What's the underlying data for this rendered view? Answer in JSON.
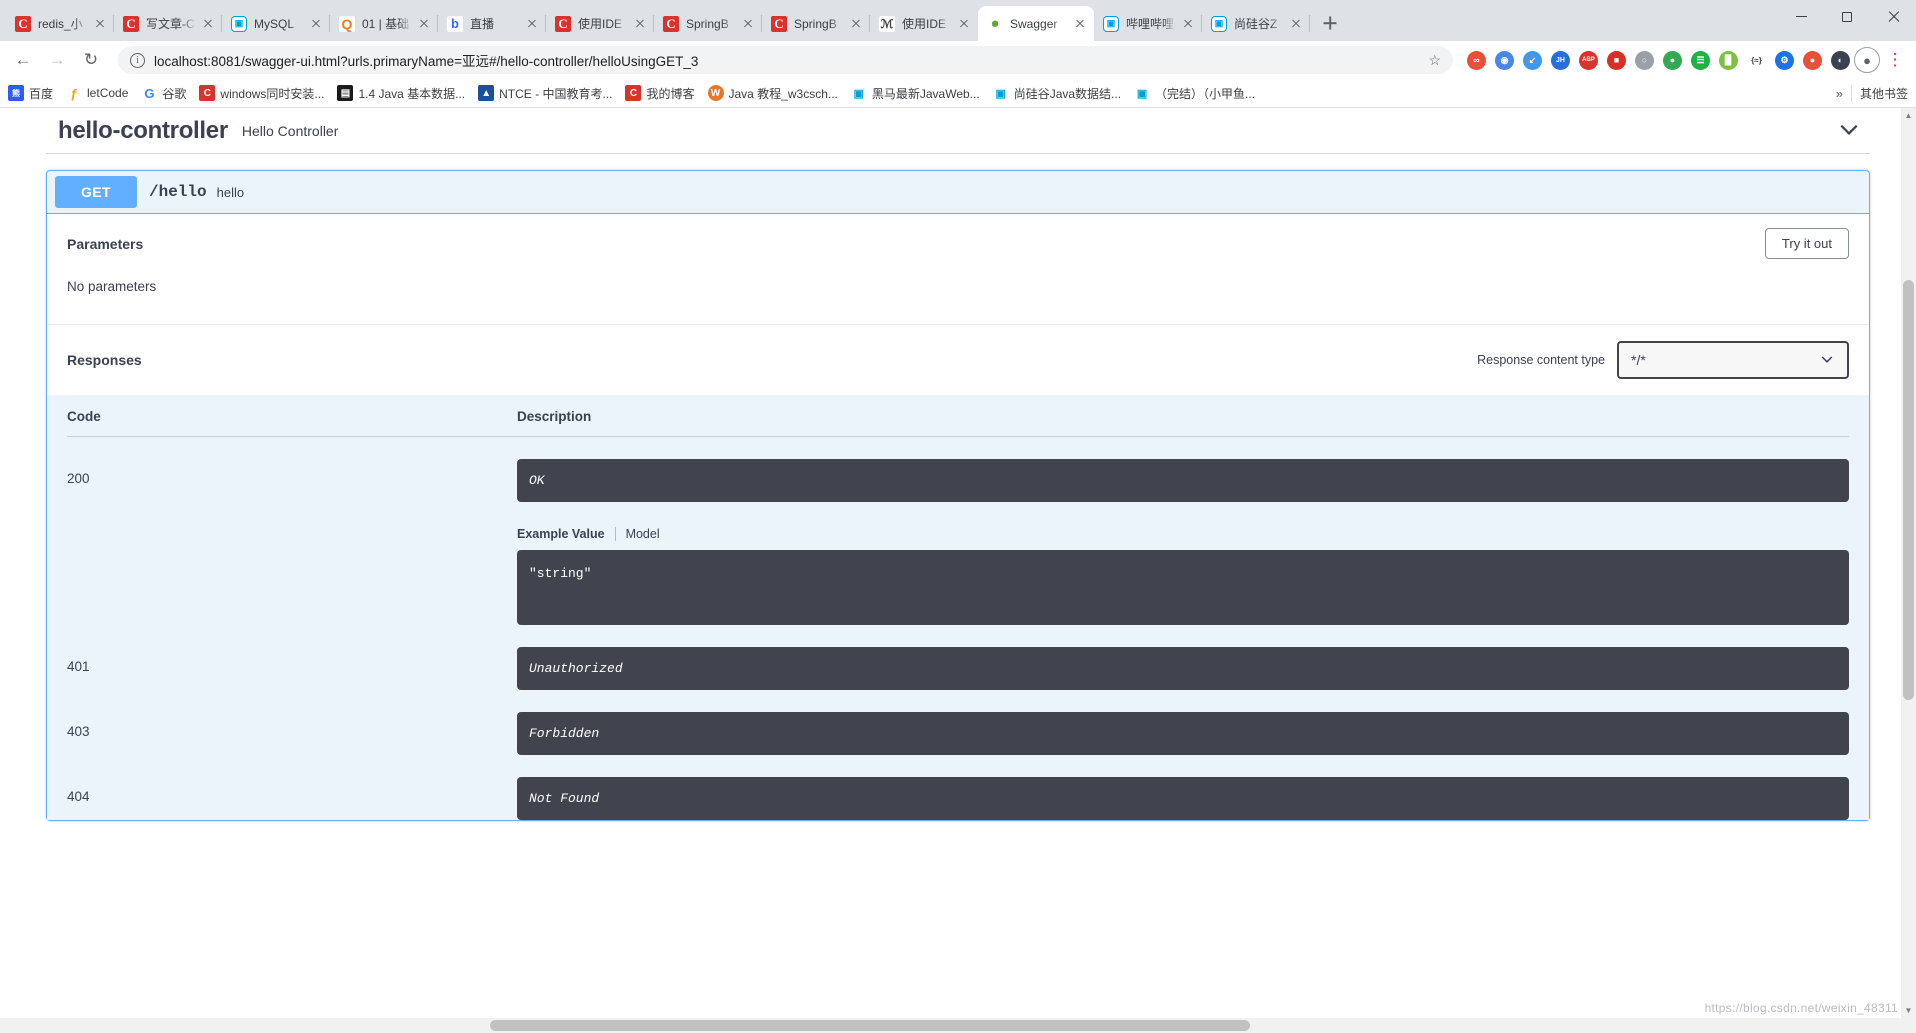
{
  "browser": {
    "tabs": [
      {
        "title": "redis_小",
        "icon": "csdn-icon",
        "icon_class": "fav-csdn",
        "glyph": "C",
        "active": false
      },
      {
        "title": "写文章-C",
        "icon": "csdn-icon",
        "icon_class": "fav-csdn",
        "glyph": "C",
        "active": false
      },
      {
        "title": "MySQL ",
        "icon": "bilibili-icon",
        "icon_class": "fav-bili",
        "glyph": "■■",
        "active": false
      },
      {
        "title": "01 | 基础",
        "icon": "qcon-icon",
        "icon_class": "fav-q",
        "glyph": "Q",
        "active": false
      },
      {
        "title": "直播",
        "icon": "zhibo-icon",
        "icon_class": "fav-zhibo",
        "glyph": "b",
        "active": false
      },
      {
        "title": "使用IDE",
        "icon": "csdn-icon",
        "icon_class": "fav-csdn",
        "glyph": "C",
        "active": false
      },
      {
        "title": "SpringB",
        "icon": "csdn-icon",
        "icon_class": "fav-csdn",
        "glyph": "C",
        "active": false
      },
      {
        "title": "SpringB",
        "icon": "csdn-icon",
        "icon_class": "fav-csdn",
        "glyph": "C",
        "active": false
      },
      {
        "title": "使用IDE",
        "icon": "page-icon",
        "icon_class": "fav-ide",
        "glyph": "Ⅎ",
        "active": false
      },
      {
        "title": "Swagger",
        "icon": "swagger-icon",
        "icon_class": "fav-swag",
        "glyph": "●",
        "active": true
      },
      {
        "title": "哔哩哔哩",
        "icon": "bilibili-icon",
        "icon_class": "fav-bili",
        "glyph": "■■",
        "active": false
      },
      {
        "title": "尚硅谷Z",
        "icon": "bilibili-icon",
        "icon_class": "fav-bili",
        "glyph": "■■",
        "active": false
      }
    ],
    "new_tab_label": "+",
    "window_controls": {
      "minimize": "minimize-button",
      "maximize": "maximize-button",
      "close": "close-button"
    },
    "nav": {
      "back": "←",
      "forward": "→",
      "reload": "↻"
    },
    "url": {
      "host": "localhost:8081",
      "path": "/swagger-ui.html?urls.primaryName=亚远#/hello-controller/helloUsingGET_3",
      "full": "localhost:8081/swagger-ui.html?urls.primaryName=亚远#/hello-controller/helloUsingGET_3"
    },
    "star_label": "☆",
    "extensions": [
      {
        "name": "extension-1",
        "color": "#e8503a",
        "glyph": "∞"
      },
      {
        "name": "extension-2",
        "color": "#4a86e8",
        "glyph": "◉"
      },
      {
        "name": "extension-3",
        "color": "#3f9aef",
        "glyph": "↙"
      },
      {
        "name": "extension-jh",
        "color": "#2a6fd6",
        "glyph": "JH"
      },
      {
        "name": "extension-abp",
        "color": "#d9332d",
        "glyph": "ABP"
      },
      {
        "name": "extension-flash",
        "color": "#d93025",
        "glyph": "■"
      },
      {
        "name": "extension-6",
        "color": "#9aa0a6",
        "glyph": "○"
      },
      {
        "name": "extension-7",
        "color": "#34a853",
        "glyph": "●"
      },
      {
        "name": "extension-8",
        "color": "#1fb141",
        "glyph": "☰"
      },
      {
        "name": "extension-9",
        "color": "#7fbf3f",
        "glyph": "▉"
      },
      {
        "name": "extension-10",
        "color": "#1a73e8",
        "glyph": "{≈}"
      },
      {
        "name": "extension-11",
        "color": "#1a73e8",
        "glyph": "⚙"
      },
      {
        "name": "extension-12",
        "color": "#e8503a",
        "glyph": "●"
      },
      {
        "name": "extension-13",
        "color": "#3b4151",
        "glyph": "◐"
      }
    ],
    "avatar_label": "●",
    "menu_label": "⋮",
    "bookmarks": [
      {
        "label": "百度",
        "color": "#2e5bff",
        "glyph": "熊"
      },
      {
        "label": "letCode",
        "color": "#ffffff",
        "glyph": "ƒ",
        "text_color": "#f89f1b"
      },
      {
        "label": "谷歌",
        "color": "#ffffff",
        "glyph": "G",
        "text_color": "#4285f4"
      },
      {
        "label": "windows同时安装...",
        "color": "#d9332d",
        "glyph": "C"
      },
      {
        "label": "1.4 Java 基本数据...",
        "color": "#1b1b1b",
        "glyph": "▤"
      },
      {
        "label": "NTCE - 中国教育考...",
        "color": "#1a4f9c",
        "glyph": "▲"
      },
      {
        "label": "我的博客",
        "color": "#d9332d",
        "glyph": "C"
      },
      {
        "label": "Java 教程_w3csch...",
        "color": "#e8772e",
        "glyph": "W"
      },
      {
        "label": "黑马最新JavaWeb...",
        "color": "#ffffff",
        "glyph": "■■",
        "text_color": "#00a1d6"
      },
      {
        "label": "尚硅谷Java数据结...",
        "color": "#ffffff",
        "glyph": "■■",
        "text_color": "#00a1d6"
      },
      {
        "label": "（完结）（小甲鱼...",
        "color": "#ffffff",
        "glyph": "■■",
        "text_color": "#00a1d6"
      }
    ],
    "bookmark_overflow": "»",
    "other_bookmarks": "其他书签"
  },
  "swagger": {
    "tag": {
      "name": "hello-controller",
      "description": "Hello Controller",
      "collapse_icon": "chevron-down-icon"
    },
    "operation": {
      "method": "GET",
      "path": "/hello",
      "summary": "hello"
    },
    "parameters": {
      "heading": "Parameters",
      "try_it_out": "Try it out",
      "empty_text": "No parameters"
    },
    "responses": {
      "heading": "Responses",
      "content_type_label": "Response content type",
      "content_type_value": "*/*",
      "content_type_options": [
        "*/*"
      ],
      "columns": {
        "code": "Code",
        "description": "Description"
      },
      "rows": [
        {
          "code": "200",
          "message": "OK",
          "has_example": true,
          "example_tabs": {
            "example": "Example Value",
            "model": "Model"
          },
          "example_value": "\"string\""
        },
        {
          "code": "401",
          "message": "Unauthorized",
          "has_example": false
        },
        {
          "code": "403",
          "message": "Forbidden",
          "has_example": false
        },
        {
          "code": "404",
          "message": "Not Found",
          "has_example": false
        }
      ]
    }
  },
  "watermark": "https://blog.csdn.net/weixin_48311",
  "colors": {
    "get_blue": "#61affe",
    "panel_bg": "#ebf3fb",
    "dark_code": "#41444e",
    "text": "#3b4151"
  }
}
